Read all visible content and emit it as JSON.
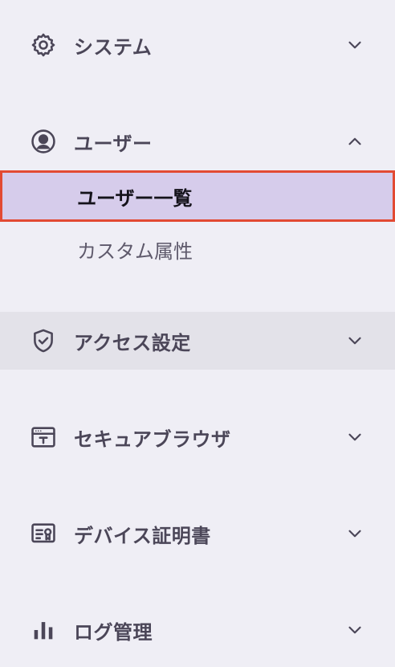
{
  "sidebar": {
    "sections": [
      {
        "label": "システム",
        "icon": "gear-icon",
        "expanded": false
      },
      {
        "label": "ユーザー",
        "icon": "user-circle-icon",
        "expanded": true,
        "items": [
          {
            "label": "ユーザー一覧",
            "selected": true
          },
          {
            "label": "カスタム属性",
            "selected": false
          }
        ]
      },
      {
        "label": "アクセス設定",
        "icon": "shield-check-icon",
        "expanded": false,
        "hovered": true
      },
      {
        "label": "セキュアブラウザ",
        "icon": "browser-window-icon",
        "expanded": false
      },
      {
        "label": "デバイス証明書",
        "icon": "certificate-icon",
        "expanded": false
      },
      {
        "label": "ログ管理",
        "icon": "bar-chart-icon",
        "expanded": false
      }
    ]
  },
  "colors": {
    "background": "#efeef5",
    "hover_background": "#e3e2e9",
    "selected_background": "#d6cceb",
    "selected_border": "#e24a33",
    "text": "#4b4658",
    "selected_text": "#14121a"
  }
}
